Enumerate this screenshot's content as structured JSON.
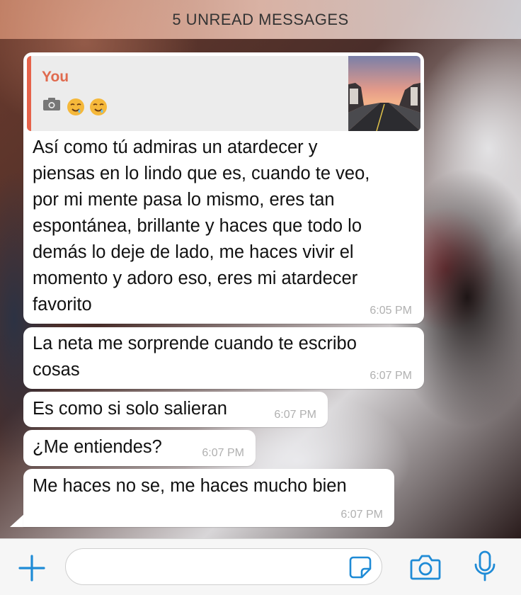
{
  "banner": {
    "text": "5 UNREAD MESSAGES"
  },
  "quoted_reply": {
    "author": "You",
    "camera_icon": "camera-icon",
    "emojis": [
      "drooling-face-emoji",
      "drooling-face-emoji"
    ]
  },
  "messages": [
    {
      "lines": [
        "Así como tú admiras un atardecer y",
        "piensas en lo lindo que es, cuando te veo,",
        "por mi mente pasa lo mismo, eres tan",
        "espontánea, brillante y haces que todo lo",
        "demás lo deje de lado, me haces vivir el",
        "momento y adoro eso, eres mi atardecer",
        "favorito"
      ],
      "time": "6:05 PM"
    },
    {
      "lines": [
        "La neta me sorprende cuando te escribo",
        "cosas"
      ],
      "time": "6:07 PM"
    },
    {
      "lines": [
        "Es como si solo salieran"
      ],
      "time": "6:07 PM"
    },
    {
      "lines": [
        "¿Me entiendes?"
      ],
      "time": "6:07 PM"
    },
    {
      "lines": [
        "Me haces no se, me haces mucho bien"
      ],
      "time": "6:07 PM"
    }
  ],
  "composer": {
    "placeholder": "",
    "icons": [
      "plus-icon",
      "sticker-icon",
      "camera-icon",
      "microphone-icon"
    ]
  },
  "colors": {
    "accent": "#1f8bd6",
    "quote_author": "#e06a4e",
    "timestamp": "#b0b0b0"
  }
}
